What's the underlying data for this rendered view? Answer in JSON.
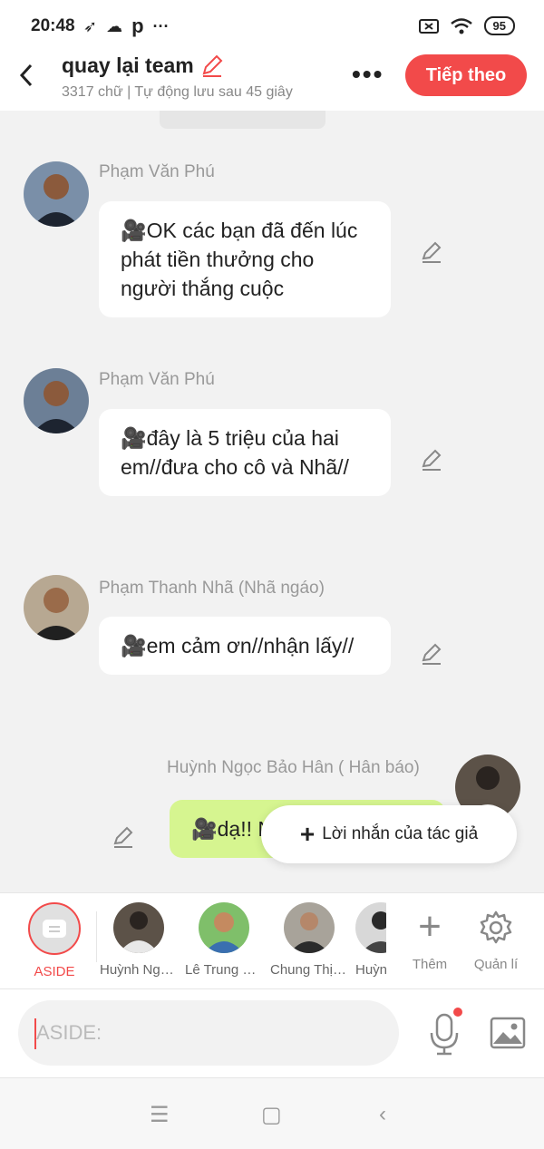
{
  "status_bar": {
    "time": "20:48",
    "battery": "95"
  },
  "header": {
    "title": "quay lại team",
    "subtitle": "3317 chữ | Tự động lưu sau 45 giây",
    "more": "•••",
    "next_button": "Tiếp theo"
  },
  "messages": [
    {
      "sender": "Phạm Văn Phú",
      "text": "🎥OK các bạn đã đến lúc phát tiền thưởng cho người thắng cuộc",
      "side": "left"
    },
    {
      "sender": "Phạm Văn Phú",
      "text": "🎥đây là 5 triệu của hai em//đưa cho cô và Nhã//",
      "side": "left"
    },
    {
      "sender": "Phạm Thanh Nhã (Nhã ngáo)",
      "text": "🎥em cảm ơn//nhận lấy//",
      "side": "left"
    },
    {
      "sender": "Huỳnh Ngọc Bảo Hân ( Hân báo)",
      "text": "🎥dạ!! Nhã//",
      "side": "right"
    }
  ],
  "popup": {
    "label": "Lời nhắn của tác giả"
  },
  "characters": [
    {
      "name": "ASIDE",
      "selected": true
    },
    {
      "name": "Huỳnh Ngọc Bảo Hân"
    },
    {
      "name": "Lê Trung Hiếu"
    },
    {
      "name": "Chung Thị Mai"
    },
    {
      "name": "Huỳnh"
    }
  ],
  "tools": {
    "add": "Thêm",
    "manage": "Quản lí"
  },
  "input": {
    "placeholder": "ASIDE:"
  },
  "colors": {
    "accent": "#f24a4a",
    "green_bubble": "#d6f590",
    "background": "#f2f2f2"
  }
}
